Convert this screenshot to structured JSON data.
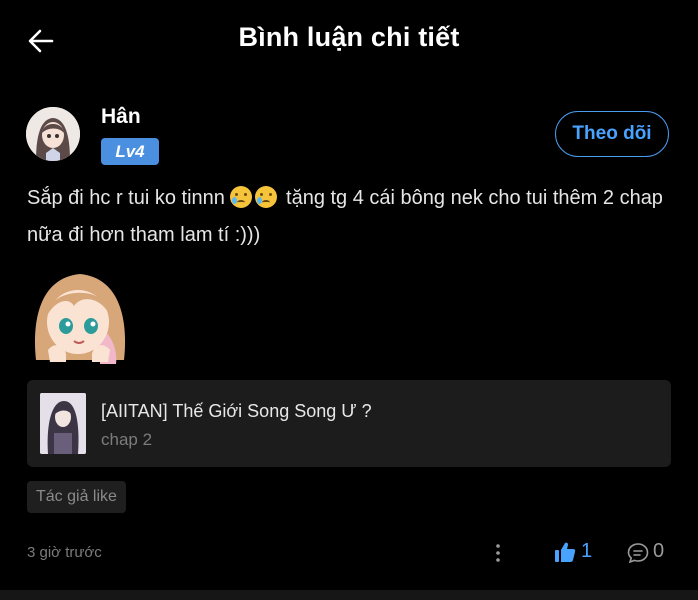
{
  "header": {
    "title": "Bình luận chi tiết"
  },
  "user": {
    "name": "Hân",
    "level": "Lv4"
  },
  "follow_label": "Theo dõi",
  "comment": {
    "text_before": "Sắp đi hc r tui ko tinnn ",
    "emojis": [
      "crying-face-emoji",
      "crying-face-emoji"
    ],
    "text_after": " tặng tg 4 cái bông nek cho tui thêm 2 chap nữa đi hơn tham lam tí :)))"
  },
  "story": {
    "title": "[AIITAN] Thế Giới Song Song Ư ?",
    "chapter": "chap 2"
  },
  "author_like": "Tác giả like",
  "timestamp": "3 giờ trước",
  "likes": "1",
  "replies": "0",
  "colors": {
    "accent": "#4aa2ff",
    "badge": "#4a8fe0",
    "card": "#1c1c1c",
    "background": "#000000"
  }
}
